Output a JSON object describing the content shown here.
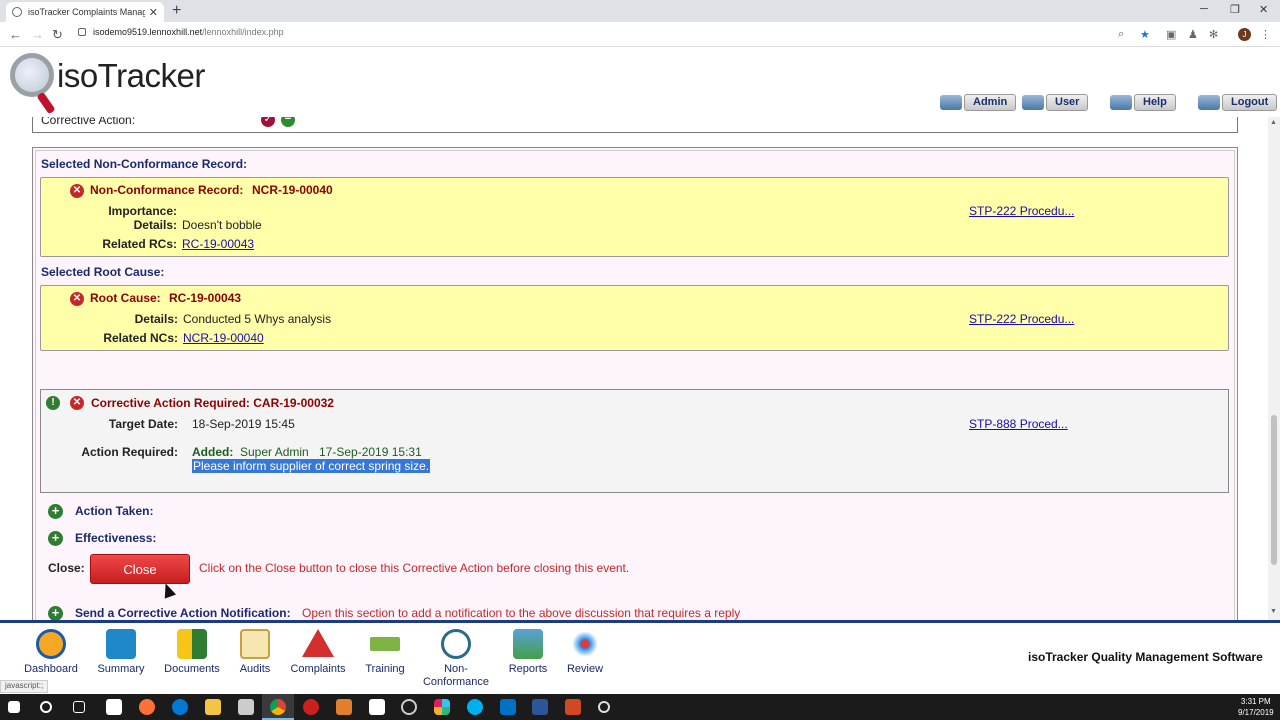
{
  "browser": {
    "tab_title": "isoTracker Complaints Managem",
    "tab_close": "✕",
    "new_tab": "+",
    "url_host": "isodemo9519.lennoxhill.net",
    "url_path": "/lennoxhill/index.php",
    "profile_initial": "J",
    "status_url": "javascript:;"
  },
  "header": {
    "logo_text": "isoTracker",
    "buttons": [
      "Admin",
      "User",
      "Help",
      "Logout"
    ]
  },
  "top_section": {
    "label": "Corrective Action:"
  },
  "ncr": {
    "section_heading": "Selected Non-Conformance Record:",
    "title_label": "Non-Conformance Record:",
    "title_id": "NCR-19-00040",
    "importance_label": "Importance:",
    "importance_value": "",
    "details_label": "Details:",
    "details_value": "Doesn't bobble",
    "related_label": "Related RCs:",
    "related_value": "RC-19-00043",
    "doc_link": "STP-222 Procedu..."
  },
  "root_cause": {
    "section_heading": "Selected Root Cause:",
    "title_label": "Root Cause:",
    "title_id": "RC-19-00043",
    "details_label": "Details:",
    "details_value": "Conducted 5 Whys analysis",
    "related_label": "Related NCs:",
    "related_value": "NCR-19-00040",
    "doc_link": "STP-222 Procedu..."
  },
  "car": {
    "title": "Corrective Action Required: CAR-19-00032",
    "target_label": "Target Date:",
    "target_value": "18-Sep-2019 15:45",
    "action_label": "Action Required:",
    "added_label": "Added:",
    "added_by": "Super Admin",
    "added_date": "17-Sep-2019 15:31",
    "action_text": "Please inform supplier of correct spring size.",
    "doc_link": "STP-888 Proced..."
  },
  "sections": {
    "action_taken": "Action Taken:",
    "effectiveness": "Effectiveness:",
    "close_label": "Close:",
    "close_button": "Close",
    "close_hint": "Click on the Close button to close this Corrective Action before closing this event.",
    "notify_label": "Send a Corrective Action Notification:",
    "notify_hint": "Open this section to add a notification to the above discussion that requires a reply"
  },
  "modules": [
    {
      "label": "Dashboard",
      "color": "#e67e22"
    },
    {
      "label": "Summary",
      "color": "#1e88c8"
    },
    {
      "label": "Documents",
      "color": "#2e7d32"
    },
    {
      "label": "Audits",
      "color": "#c8a040"
    },
    {
      "label": "Complaints",
      "color": "#d32f2f"
    },
    {
      "label": "Training",
      "color": "#7cb342"
    },
    {
      "label": "Non-\nConformance",
      "color": "#2a6a8a"
    },
    {
      "label": "Reports",
      "color": "#43a047"
    },
    {
      "label": "Review",
      "color": "#e53935"
    }
  ],
  "brand": "isoTracker Quality Management Software",
  "taskbar": {
    "time": "3:31 PM",
    "date": "9/17/2019"
  }
}
